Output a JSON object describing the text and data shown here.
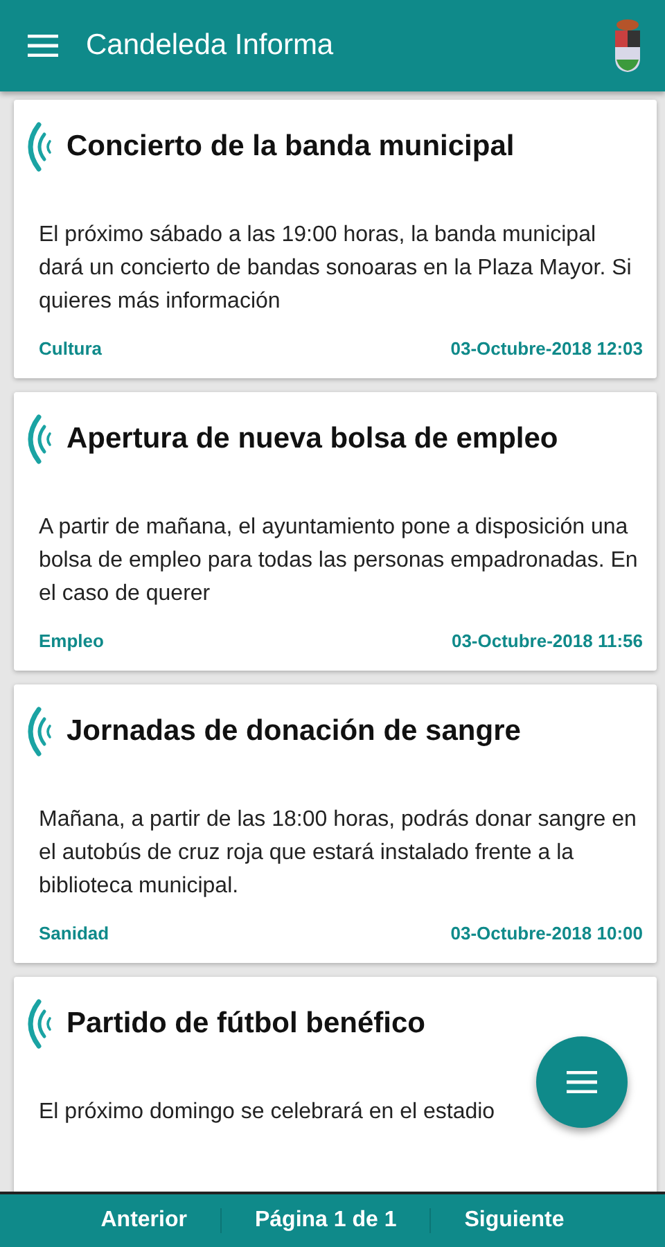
{
  "app_bar": {
    "title": "Candeleda Informa"
  },
  "news": [
    {
      "title": "Concierto de la banda municipal",
      "body": "El próximo sábado a las 19:00 horas, la banda municipal dará un concierto de bandas sonoaras en la Plaza Mayor. Si quieres más información",
      "category": "Cultura",
      "date": "03-Octubre-2018 12:03"
    },
    {
      "title": "Apertura de nueva bolsa de empleo",
      "body": "A partir de mañana, el ayuntamiento pone a disposición una bolsa de empleo para todas las personas empadronadas. En el caso de querer",
      "category": "Empleo",
      "date": "03-Octubre-2018 11:56"
    },
    {
      "title": "Jornadas de donación de sangre",
      "body": "Mañana, a partir de las 18:00 horas, podrás donar sangre en el autobús de cruz roja que estará instalado frente a la biblioteca municipal.",
      "category": "Sanidad",
      "date": "03-Octubre-2018 10:00"
    },
    {
      "title": "Partido de fútbol benéfico",
      "body": "El próximo domingo se celebrará en el estadio"
    }
  ],
  "pager": {
    "previous": "Anterior",
    "page": "Página 1 de 1",
    "next": "Siguiente"
  }
}
